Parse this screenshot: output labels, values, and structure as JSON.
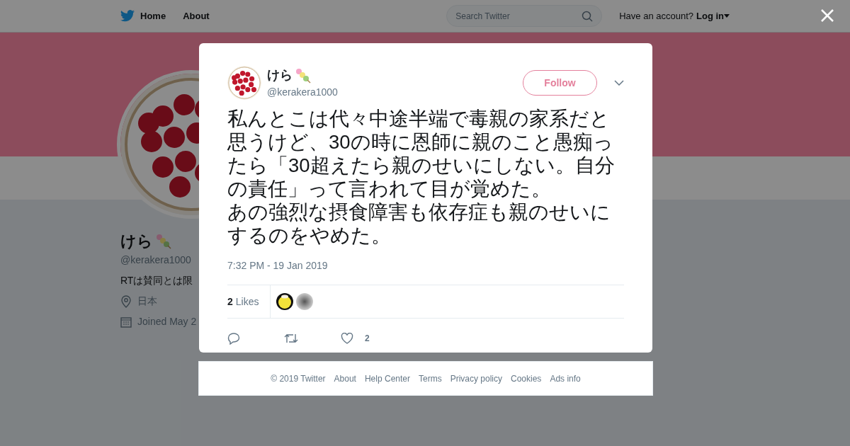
{
  "top_nav": {
    "links": [
      {
        "label": "Home",
        "kind": "home"
      },
      {
        "label": "About",
        "kind": "plain"
      }
    ],
    "search": {
      "placeholder": "Search Twitter"
    },
    "account_prompt": "Have an account?",
    "login": "Log in"
  },
  "profile": {
    "name": "けら",
    "handle": "@kerakera1000",
    "bio": "RTは賛同とは限",
    "location": "日本",
    "joined": "Joined May 2"
  },
  "tweet": {
    "author": {
      "name": "けら",
      "handle": "@kerakera1000"
    },
    "follow_button": "Follow",
    "paragraphs": [
      "私んとこは代々中途半端で毒親の家系だと思うけど、30の時に恩師に親のこと愚痴ったら「30超えたら親のせいにしない。自分の責任」って言われて目が覚めた。",
      "あの強烈な摂食障害も依存症も親のせいにするのをやめた。"
    ],
    "timestamp": "7:32 PM - 19 Jan 2019",
    "likes": {
      "count": "2",
      "label": "Likes"
    },
    "like_count": "2"
  },
  "footer": {
    "links": [
      "© 2019 Twitter",
      "About",
      "Help Center",
      "Terms",
      "Privacy policy",
      "Cookies",
      "Ads info"
    ]
  }
}
